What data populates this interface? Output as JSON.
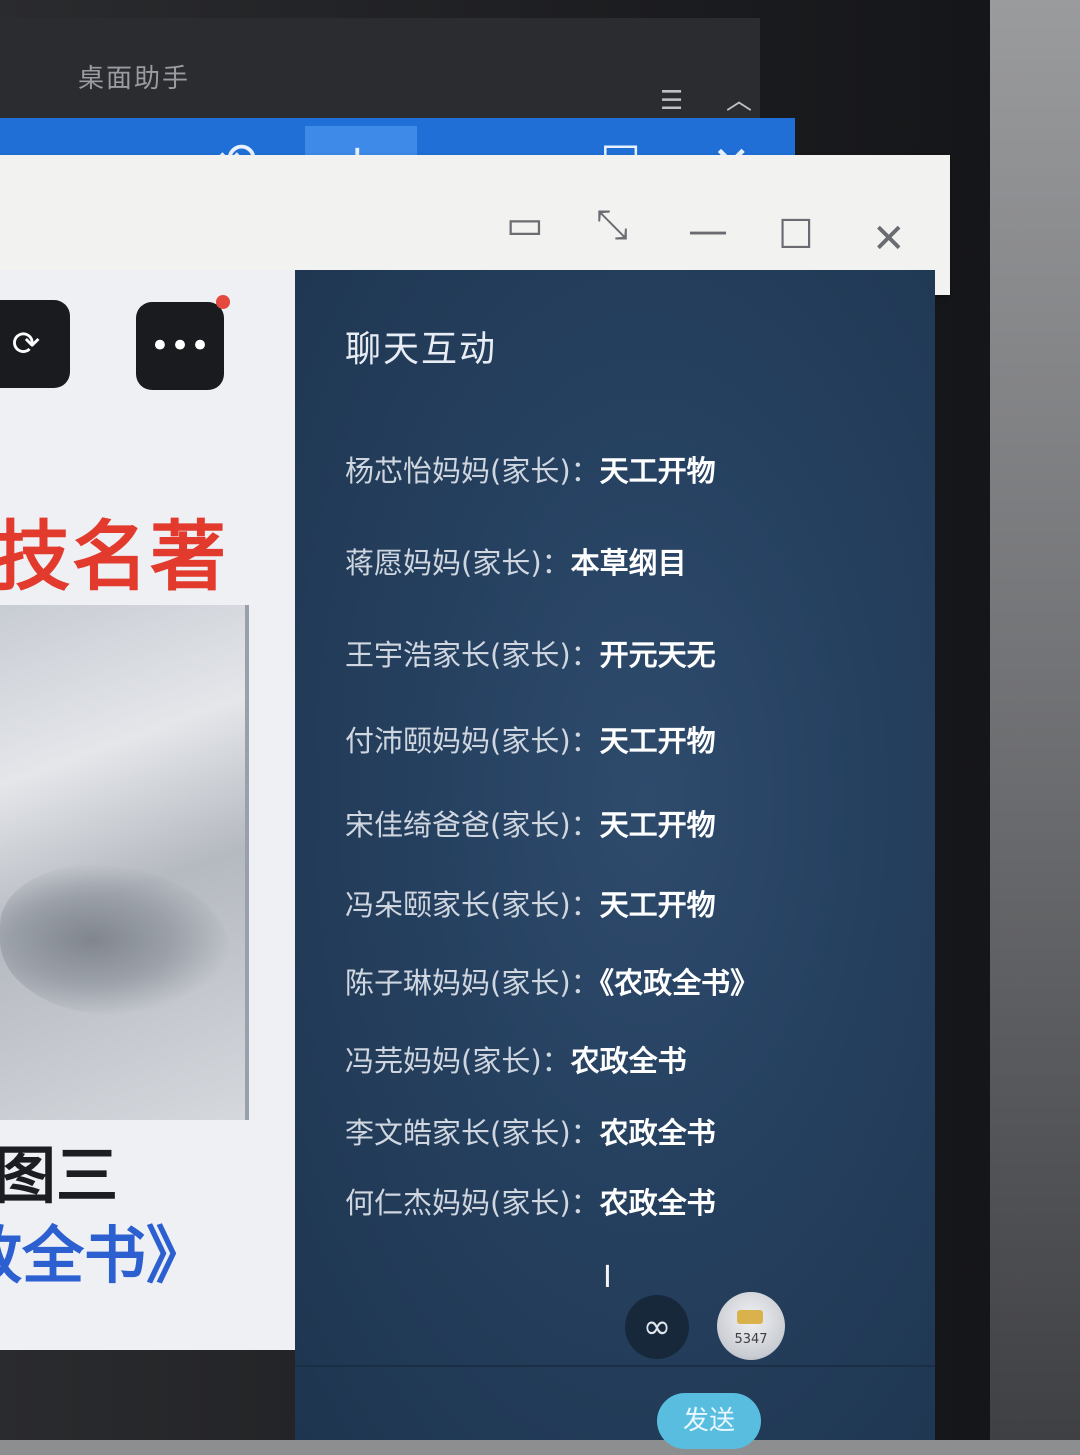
{
  "helper_window": {
    "title": "桌面助手",
    "menu_icon": "menu-icon",
    "collapse_icon": "chevron-up-icon",
    "toolbar": {
      "history_icon": "history-icon",
      "add_label": "+",
      "minimize_label": "—",
      "maximize_label": "☐",
      "close_label": "✕"
    }
  },
  "main_window": {
    "titlebar": {
      "pin_icon": "window-pin-icon",
      "resize_icon": "expand-arrows-icon",
      "minimize_label": "—",
      "maximize_label": "☐",
      "close_label": "✕"
    }
  },
  "slide": {
    "rotate_icon": "rotate-icon",
    "more_label": "•••",
    "title": "技名著",
    "caption": "图三",
    "book_title": "政全书》"
  },
  "chat": {
    "title": "聊天互动",
    "messages": [
      {
        "sender": "杨芯怡妈妈(家长)：",
        "content": "天工开物"
      },
      {
        "sender": "蒋愿妈妈(家长)：",
        "content": "本草纲目"
      },
      {
        "sender": "王宇浩家长(家长)：",
        "content": "开元天无"
      },
      {
        "sender": "付沛颐妈妈(家长)：",
        "content": "天工开物"
      },
      {
        "sender": "宋佳绮爸爸(家长)：",
        "content": "天工开物"
      },
      {
        "sender": "冯朵颐家长(家长)：",
        "content": "天工开物"
      },
      {
        "sender": "陈子琳妈妈(家长)：",
        "content": "《农政全书》"
      },
      {
        "sender": "冯芫妈妈(家长)：",
        "content": "农政全书"
      },
      {
        "sender": "李文皓家长(家长)：",
        "content": "农政全书"
      },
      {
        "sender": "何仁杰妈妈(家长)：",
        "content": "农政全书"
      }
    ],
    "link_icon": "link-icon",
    "avatar_count": "5347",
    "send_label": "发送"
  }
}
